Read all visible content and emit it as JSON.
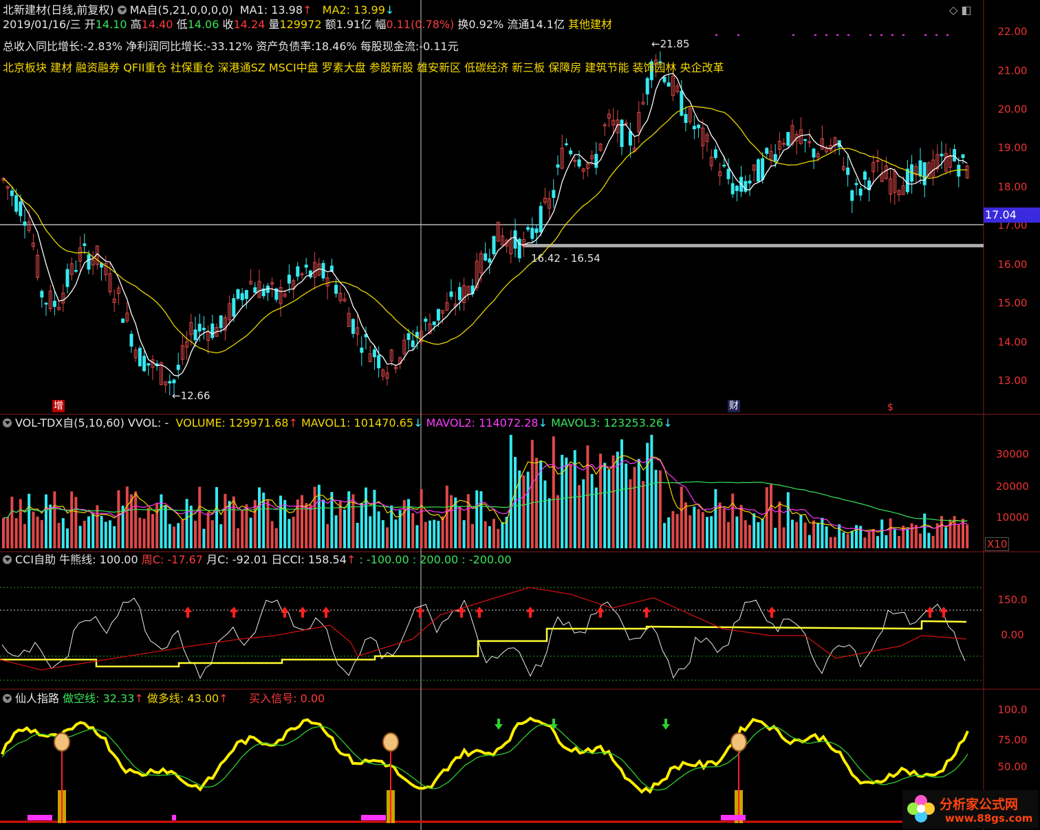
{
  "main_header": {
    "stock_name": "北新建材(日线,前复权)",
    "ma_indicator": "MA自(5,21,0,0,0,0)",
    "ma1": "MA1: 13.98",
    "ma1_arrow": "↑",
    "ma2": "MA2: 13.99",
    "ma2_arrow": "↓"
  },
  "quote_line": {
    "date": "2019/01/16/三",
    "open_label": "开",
    "open": "14.10",
    "high_label": "高",
    "high": "14.40",
    "low_label": "低",
    "low": "14.06",
    "close_label": "收",
    "close": "14.24",
    "vol_label": "量",
    "vol": "129972",
    "amount": "额1.91亿",
    "change_label": "幅",
    "change": "0.11",
    "change_pct": "(0.78%)",
    "turnover": "换0.92%",
    "float_cap": "流通14.1亿",
    "industry": "其他建材"
  },
  "fundamentals": "总收入同比增长:-2.83%  净利润同比增长:-33.12%  资产负债率:18.46%  每股现金流:-0.11元",
  "concepts": "北京板块 建材 融资融券 QFII重仓 社保重仓 深港通SZ MSCI中盘 罗素大盘 参股新股 雄安新区 低碳经济 新三板 保障房 建筑节能 装饰园林 央企改革",
  "price_axis": [
    "22.00",
    "21.00",
    "20.00",
    "19.00",
    "18.00",
    "17.00",
    "16.00",
    "15.00",
    "14.00",
    "13.00"
  ],
  "price_tag": "17.04",
  "annotations": {
    "high": "21.85",
    "low": "12.66",
    "range": "16.42 - 16.54"
  },
  "markers": {
    "zeng": "增",
    "cai": "财",
    "dollar": "$"
  },
  "vol_panel": {
    "title": "VOL-TDX自(5,10,60)",
    "vvol": "VVOL: -",
    "volume": "VOLUME: 129971.68",
    "volume_arrow": "↑",
    "mavol1": "MAVOL1: 101470.65",
    "mavol1_arrow": "↓",
    "mavol2": "MAVOL2: 114072.28",
    "mavol2_arrow": "↓",
    "mavol3": "MAVOL3: 123253.26",
    "mavol3_arrow": "↓",
    "axis": [
      "30000",
      "20000",
      "10000"
    ],
    "unit": "X10"
  },
  "cci_panel": {
    "title": "CCI自助",
    "bull_bear": "牛熊线: 100.00",
    "week": "周C: -17.67",
    "month": "月C: -92.01",
    "day": "日CCI: 158.54",
    "day_arrow": "↑",
    "levels": ": -100.00  : 200.00  : -200.00",
    "axis": [
      "150.0",
      "0.00"
    ]
  },
  "xr_panel": {
    "title": "仙人指路",
    "short_line": "做空线: 32.33",
    "short_arrow": "↑",
    "long_line": "做多线: 43.00",
    "long_arrow": "↑",
    "buy_signal": "买入信号: 0.00",
    "axis": [
      "100.0",
      "75.00",
      "50.00"
    ]
  },
  "watermark": {
    "brand": "分析家公式网",
    "url": "www.88gs.com"
  },
  "colors": {
    "up": "#e04848",
    "down": "#36e8f0",
    "ma5": "#ffffff",
    "ma21": "#e8d800",
    "accent": "#3a2adf"
  }
}
